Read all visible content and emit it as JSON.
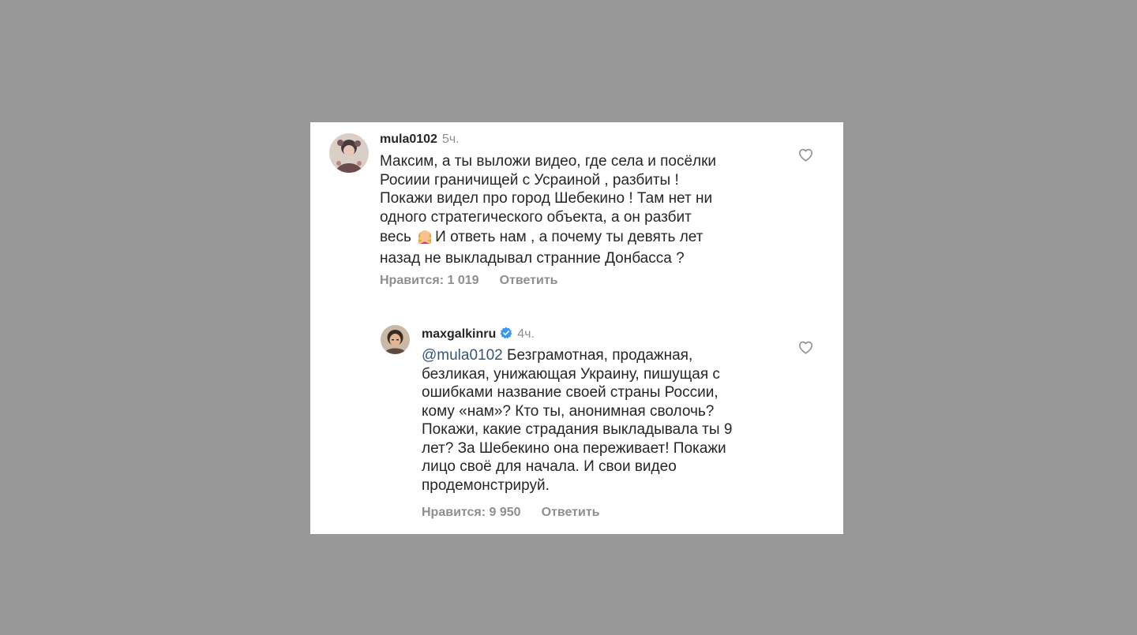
{
  "comments": [
    {
      "username": "mula0102",
      "time": "5ч.",
      "text_lines": [
        "Максим, а ты выложи видео, где села и посёлки",
        "Росиии граничищей с Усраиной , разбиты !",
        "Покажи видел про город Шебекино ! Там нет ни",
        "одного стратегического объекта, а он разбит"
      ],
      "line5_before_emoji": "весь",
      "emoji": "woman-gesturing-no-emoji",
      "line5_after_emoji": "И ответь нам , а почему ты девять лет",
      "line6": "назад не выкладывал странние Донбасса ?",
      "likes_label": "Нравится: 1 019",
      "reply_label": "Ответить",
      "like_icon": "heart-icon"
    },
    {
      "username": "maxgalkinru",
      "verified": true,
      "time": "4ч.",
      "mention": "@mula0102",
      "line1_after_mention": "Безграмотная, продажная,",
      "text_lines": [
        "безликая, унижающая Украину, пишущая с",
        "ошибками название своей страны России,",
        "кому «нам»? Кто ты, анонимная сволочь?",
        "Покажи, какие страдания выкладывала ты 9",
        "лет? За Шебекино она переживает! Покажи",
        "лицо своё для начала. И свои видео",
        "продемонстрируй."
      ],
      "likes_label": "Нравится: 9 950",
      "reply_label": "Ответить",
      "like_icon": "heart-icon"
    }
  ],
  "colors": {
    "background": "#989898",
    "card": "#ffffff",
    "text": "#262626",
    "secondary": "#8e8e8e",
    "mention": "#36567a",
    "verified": "#3897f0"
  }
}
